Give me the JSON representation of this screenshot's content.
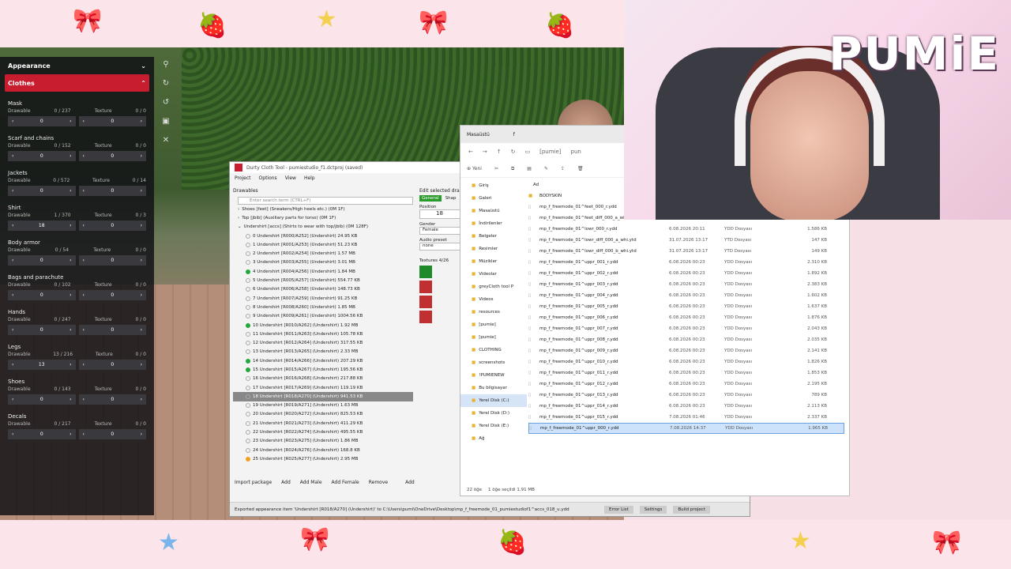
{
  "colors": {
    "accent": "#c81d2e",
    "selection": "#cde3fb"
  },
  "menu": {
    "header": "Appearance",
    "active": "Clothes",
    "categories": [
      {
        "title": "Mask",
        "drawable_label": "Drawable",
        "drawable_count": "0 / 237",
        "texture_label": "Texture",
        "texture_count": "0 / 0",
        "drawable_value": "0",
        "texture_value": "0"
      },
      {
        "title": "Scarf and chains",
        "drawable_label": "Drawable",
        "drawable_count": "0 / 152",
        "texture_label": "Texture",
        "texture_count": "0 / 0",
        "drawable_value": "0",
        "texture_value": "0"
      },
      {
        "title": "Jackets",
        "drawable_label": "Drawable",
        "drawable_count": "0 / 572",
        "texture_label": "Texture",
        "texture_count": "0 / 14",
        "drawable_value": "0",
        "texture_value": "0"
      },
      {
        "title": "Shirt",
        "drawable_label": "Drawable",
        "drawable_count": "1 / 370",
        "texture_label": "Texture",
        "texture_count": "0 / 3",
        "drawable_value": "18",
        "texture_value": "0"
      },
      {
        "title": "Body armor",
        "drawable_label": "Drawable",
        "drawable_count": "0 / 54",
        "texture_label": "Texture",
        "texture_count": "0 / 0",
        "drawable_value": "0",
        "texture_value": "0"
      },
      {
        "title": "Bags and parachute",
        "drawable_label": "Drawable",
        "drawable_count": "0 / 102",
        "texture_label": "Texture",
        "texture_count": "0 / 0",
        "drawable_value": "0",
        "texture_value": "0"
      },
      {
        "title": "Hands",
        "drawable_label": "Drawable",
        "drawable_count": "0 / 247",
        "texture_label": "Texture",
        "texture_count": "0 / 0",
        "drawable_value": "0",
        "texture_value": "0"
      },
      {
        "title": "Legs",
        "drawable_label": "Drawable",
        "drawable_count": "13 / 216",
        "texture_label": "Texture",
        "texture_count": "0 / 0",
        "drawable_value": "13",
        "texture_value": "0"
      },
      {
        "title": "Shoes",
        "drawable_label": "Drawable",
        "drawable_count": "0 / 143",
        "texture_label": "Texture",
        "texture_count": "0 / 0",
        "drawable_value": "0",
        "texture_value": "0"
      },
      {
        "title": "Decals",
        "drawable_label": "Drawable",
        "drawable_count": "0 / 217",
        "texture_label": "Texture",
        "texture_count": "0 / 0",
        "drawable_value": "0",
        "texture_value": "0"
      }
    ]
  },
  "dct": {
    "title": "Durty Cloth Tool - pumiestudio_f1.dctproj (saved)",
    "menu": [
      "Project",
      "Options",
      "View",
      "Help"
    ],
    "drawables_label": "Drawables",
    "search_placeholder": "Enter search term (CTRL+F)",
    "groups": [
      "Shoes [feet] (Sneakers/High heels etc.) (0M 1F)",
      "Top [jbib] (Auxiliary parts for torso) (0M 1F)",
      "Undershirt [accs] (Shirts to wear with top/jbib) (0M 128F)"
    ],
    "items": [
      {
        "text": "0 Undershirt [R000/A252] (Undershirt) 24.95 KB",
        "status": "none"
      },
      {
        "text": "1 Undershirt [R001/A253] (Undershirt) 51.23 KB",
        "status": "none"
      },
      {
        "text": "2 Undershirt [R002/A254] (Undershirt) 1.57 MB",
        "status": "none"
      },
      {
        "text": "3 Undershirt [R003/A255] (Undershirt) 3.01 MB",
        "status": "none"
      },
      {
        "text": "4 Undershirt [R004/A256] (Undershirt) 1.84 MB",
        "status": "green"
      },
      {
        "text": "5 Undershirt [R005/A257] (Undershirt) 554.77 KB",
        "status": "none"
      },
      {
        "text": "6 Undershirt [R006/A258] (Undershirt) 148.73 KB",
        "status": "none"
      },
      {
        "text": "7 Undershirt [R007/A259] (Undershirt) 91.25 KB",
        "status": "none"
      },
      {
        "text": "8 Undershirt [R008/A260] (Undershirt) 1.85 MB",
        "status": "none"
      },
      {
        "text": "9 Undershirt [R009/A261] (Undershirt) 1004.56 KB",
        "status": "none"
      },
      {
        "text": "10 Undershirt [R010/A262] (Undershirt) 1.92 MB",
        "status": "green"
      },
      {
        "text": "11 Undershirt [R011/A263] (Undershirt) 105.78 KB",
        "status": "none"
      },
      {
        "text": "12 Undershirt [R012/A264] (Undershirt) 317.55 KB",
        "status": "none"
      },
      {
        "text": "13 Undershirt [R013/A265] (Undershirt) 2.33 MB",
        "status": "none"
      },
      {
        "text": "14 Undershirt [R014/A266] (Undershirt) 207.29 KB",
        "status": "green"
      },
      {
        "text": "15 Undershirt [R015/A267] (Undershirt) 195.56 KB",
        "status": "green"
      },
      {
        "text": "16 Undershirt [R016/A268] (Undershirt) 217.88 KB",
        "status": "none"
      },
      {
        "text": "17 Undershirt [R017/A269] (Undershirt) 119.19 KB",
        "status": "none"
      },
      {
        "text": "18 Undershirt [R018/A270] (Undershirt) 941.53 KB",
        "status": "selected"
      },
      {
        "text": "19 Undershirt [R019/A271] (Undershirt) 1.63 MB",
        "status": "none"
      },
      {
        "text": "20 Undershirt [R020/A272] (Undershirt) 825.53 KB",
        "status": "none"
      },
      {
        "text": "21 Undershirt [R021/A273] (Undershirt) 411.29 KB",
        "status": "none"
      },
      {
        "text": "22 Undershirt [R022/A274] (Undershirt) 495.55 KB",
        "status": "none"
      },
      {
        "text": "23 Undershirt [R023/A275] (Undershirt) 1.86 MB",
        "status": "none"
      },
      {
        "text": "24 Undershirt [R024/A276] (Undershirt) 168.8 KB",
        "status": "none"
      },
      {
        "text": "25 Undershirt [R025/A277] (Undershirt) 2.95 MB",
        "status": "warn"
      }
    ],
    "edit_label": "Edit selected dra",
    "edit_tabs": [
      "General",
      "Shap"
    ],
    "position_label": "Position",
    "position_value": "18",
    "gender_label": "Gender",
    "gender_value": "Female",
    "audio_label": "Audio preset",
    "audio_value": "none",
    "textures_label": "Textures 4/26",
    "bottom_buttons": [
      "Import package",
      "Add",
      "Add Male",
      "Add Female",
      "Remove"
    ],
    "edit_add": "Add",
    "status_text": "Exported appearance item 'Undershirt [R018/A270] (Undershirt)' to C:\\Users\\pumi\\OneDrive\\Desktop\\mp_f_freemode_01_pumiestudiof1^accs_018_u.ydd",
    "status_buttons": [
      "Error List",
      "Settings",
      "Build project"
    ]
  },
  "explorer": {
    "tabs": [
      "Masaüstü",
      "f"
    ],
    "path_pills": [
      "[pumie]",
      "pun"
    ],
    "new_label": "Yeni",
    "sidebar": [
      "Giriş",
      "Galeri",
      "Masaüstü",
      "İndirilenler",
      "Belgeler",
      "Resimler",
      "Müzikler",
      "Videolar",
      "greyCloth tool P",
      "Videos",
      "resources",
      "[pumie]",
      "[pumie]",
      "CLOTHING",
      "screenshots",
      "!PUMIENEW",
      "Bu bilgisayar",
      "Yerel Disk (C:)",
      "Yerel Disk (D:)",
      "Yerel Disk (E:)",
      "Ağ"
    ],
    "column_name": "Ad",
    "files": [
      {
        "name": "BODYSKIN",
        "date": "",
        "type": "",
        "size": ""
      },
      {
        "name": "mp_f_freemode_01^feet_000_r.ydd",
        "date": "",
        "type": "",
        "size": ""
      },
      {
        "name": "mp_f_freemode_01^feet_diff_000_a_wh",
        "date": "",
        "type": "",
        "size": ""
      },
      {
        "name": "mp_f_freemode_01^lowr_000_r.ydd",
        "date": "6.08.2026 20:11",
        "type": "YDD Dosyası",
        "size": "1.586 KB"
      },
      {
        "name": "mp_f_freemode_01^lowr_diff_000_a_whi.ytd",
        "date": "31.07.2026 13:17",
        "type": "YTD Dosyası",
        "size": "147 KB"
      },
      {
        "name": "mp_f_freemode_01^lowr_diff_000_b_whi.ytd",
        "date": "31.07.2026 13:17",
        "type": "YTD Dosyası",
        "size": "149 KB"
      },
      {
        "name": "mp_f_freemode_01^uppr_001_r.ydd",
        "date": "6.08.2026 00:23",
        "type": "YDD Dosyası",
        "size": "2.310 KB"
      },
      {
        "name": "mp_f_freemode_01^uppr_002_r.ydd",
        "date": "6.08.2026 00:23",
        "type": "YDD Dosyası",
        "size": "1.892 KB"
      },
      {
        "name": "mp_f_freemode_01^uppr_003_r.ydd",
        "date": "6.08.2026 00:23",
        "type": "YDD Dosyası",
        "size": "2.383 KB"
      },
      {
        "name": "mp_f_freemode_01^uppr_004_r.ydd",
        "date": "6.08.2026 00:23",
        "type": "YDD Dosyası",
        "size": "1.602 KB"
      },
      {
        "name": "mp_f_freemode_01^uppr_005_r.ydd",
        "date": "6.08.2026 00:23",
        "type": "YDD Dosyası",
        "size": "1.637 KB"
      },
      {
        "name": "mp_f_freemode_01^uppr_006_r.ydd",
        "date": "6.08.2026 00:23",
        "type": "YDD Dosyası",
        "size": "1.876 KB"
      },
      {
        "name": "mp_f_freemode_01^uppr_007_r.ydd",
        "date": "6.08.2026 00:23",
        "type": "YDD Dosyası",
        "size": "2.043 KB"
      },
      {
        "name": "mp_f_freemode_01^uppr_008_r.ydd",
        "date": "6.08.2026 00:23",
        "type": "YDD Dosyası",
        "size": "2.035 KB"
      },
      {
        "name": "mp_f_freemode_01^uppr_009_r.ydd",
        "date": "6.08.2026 00:23",
        "type": "YDD Dosyası",
        "size": "2.141 KB"
      },
      {
        "name": "mp_f_freemode_01^uppr_010_r.ydd",
        "date": "6.08.2026 00:23",
        "type": "YDD Dosyası",
        "size": "1.826 KB"
      },
      {
        "name": "mp_f_freemode_01^uppr_011_r.ydd",
        "date": "6.08.2026 00:23",
        "type": "YDD Dosyası",
        "size": "1.853 KB"
      },
      {
        "name": "mp_f_freemode_01^uppr_012_r.ydd",
        "date": "6.08.2026 00:23",
        "type": "YDD Dosyası",
        "size": "2.195 KB"
      },
      {
        "name": "mp_f_freemode_01^uppr_013_r.ydd",
        "date": "6.08.2026 00:23",
        "type": "YDD Dosyası",
        "size": "789 KB"
      },
      {
        "name": "mp_f_freemode_01^uppr_014_r.ydd",
        "date": "6.08.2026 00:23",
        "type": "YDD Dosyası",
        "size": "2.113 KB"
      },
      {
        "name": "mp_f_freemode_01^uppr_015_r.ydd",
        "date": "7.08.2026 01:46",
        "type": "YDD Dosyası",
        "size": "2.337 KB"
      },
      {
        "name": "mp_f_freemode_01^uppr_000_r.ydd",
        "date": "7.08.2026 14:37",
        "type": "YDD Dosyası",
        "size": "1.965 KB"
      }
    ],
    "selected_index": 21,
    "status_count": "22 öğe",
    "status_selected": "1 öğe seçildi 1,91 MB"
  },
  "webcam": {
    "logo": "PUMiE"
  }
}
